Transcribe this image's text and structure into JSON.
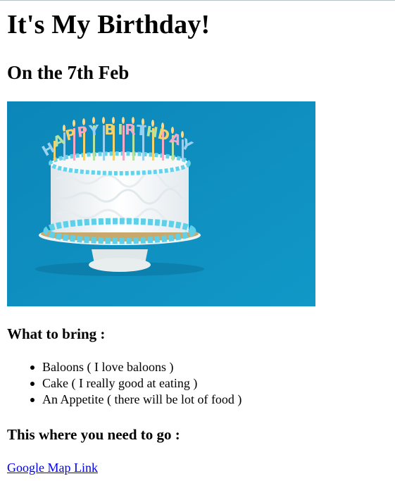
{
  "page": {
    "title": "It's My Birthday!",
    "subtitle": "On the 7th Feb",
    "image": {
      "icon": "birthday-cake-image",
      "candle_text": [
        "H",
        "A",
        "P",
        "P",
        "Y",
        " ",
        "B",
        "I",
        "R",
        "T",
        "H",
        "D",
        "A",
        "Y"
      ],
      "colors": {
        "background": "#0f8fc0",
        "frosting": "#f4f6f6",
        "accent": "#5fd0e8",
        "plate": "#e9eeee"
      }
    },
    "bring_heading": "What to bring :",
    "bring_items": [
      "Baloons ( I love baloons )",
      "Cake ( I really good at eating )",
      "An Appetite ( there will be lot of food )"
    ],
    "go_heading": "This where you need to go :",
    "map_link": "Google Map Link"
  }
}
